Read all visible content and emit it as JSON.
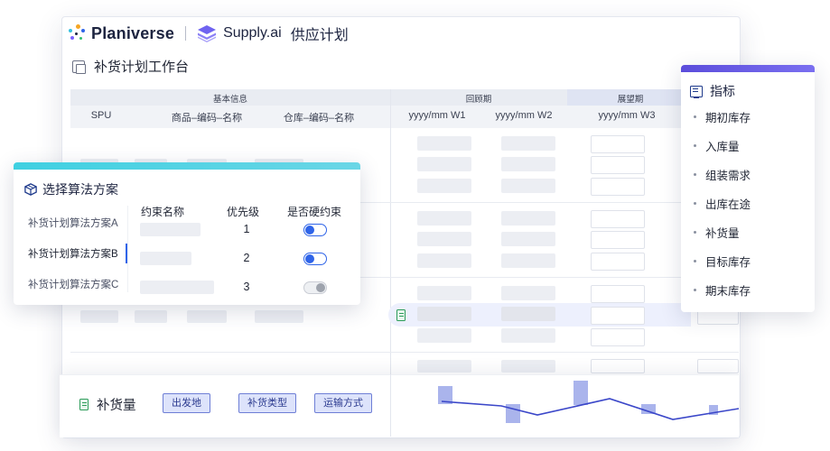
{
  "header": {
    "brand": "Planiverse",
    "product": "Supply.ai",
    "title": "供应计划"
  },
  "workspace": {
    "title": "补货计划工作台"
  },
  "table": {
    "groups": [
      "基本信息",
      "回顾期",
      "展望期"
    ],
    "columns": [
      "SPU",
      "商品–编码–名称",
      "仓库–编码–名称",
      "yyyy/mm  W1",
      "yyyy/mm  W2",
      "yyyy/mm  W3"
    ]
  },
  "algo_panel": {
    "title": "选择算法方案",
    "schemes": [
      "补货计划算法方案A",
      "补货计划算法方案B",
      "补货计划算法方案C"
    ],
    "selected_index": 1,
    "columns": [
      "约束名称",
      "优先级",
      "是否硬约束"
    ],
    "rows": [
      {
        "priority": "1",
        "hard": true
      },
      {
        "priority": "2",
        "hard": true
      },
      {
        "priority": "3",
        "hard": false
      }
    ]
  },
  "indicator_panel": {
    "title": "指标",
    "items": [
      "期初库存",
      "入库量",
      "组装需求",
      "出库在途",
      "补货量",
      "目标库存",
      "期末库存"
    ]
  },
  "bottom": {
    "label": "补货量",
    "tags": [
      "出发地",
      "补货类型",
      "运输方式"
    ]
  },
  "colors": {
    "accent": "#2f64e8",
    "algo_bar": "#3fd0e1",
    "indicator_bar": "#5b4ddb",
    "chart_bar": "#aab4ec",
    "chart_line": "#3b47c9"
  }
}
